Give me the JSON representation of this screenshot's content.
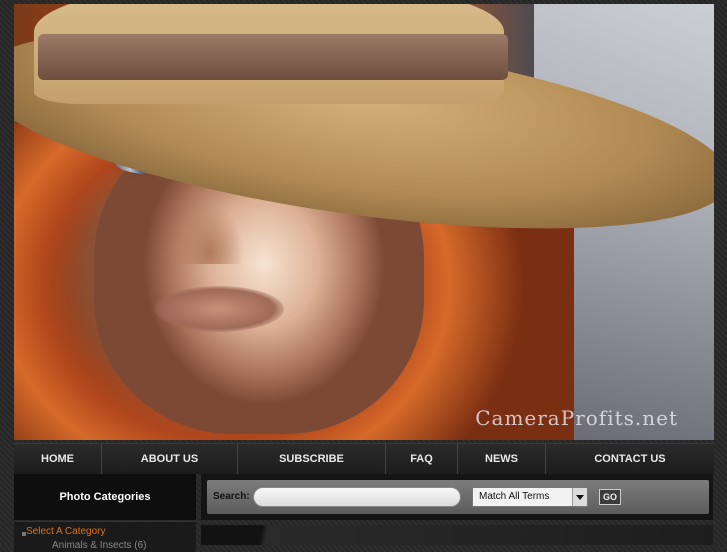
{
  "hero": {
    "watermark": "CameraProfits.net"
  },
  "nav": {
    "items": [
      {
        "label": "HOME"
      },
      {
        "label": "ABOUT US"
      },
      {
        "label": "SUBSCRIBE"
      },
      {
        "label": "FAQ"
      },
      {
        "label": "NEWS"
      },
      {
        "label": "CONTACT US"
      }
    ]
  },
  "sidebar": {
    "title": "Photo Categories",
    "select_label": "Select A Category",
    "first_item": "Animals & Insects (6)"
  },
  "search": {
    "label": "Search:",
    "value": "",
    "match_option": "Match All Terms",
    "go_label": "GO"
  }
}
